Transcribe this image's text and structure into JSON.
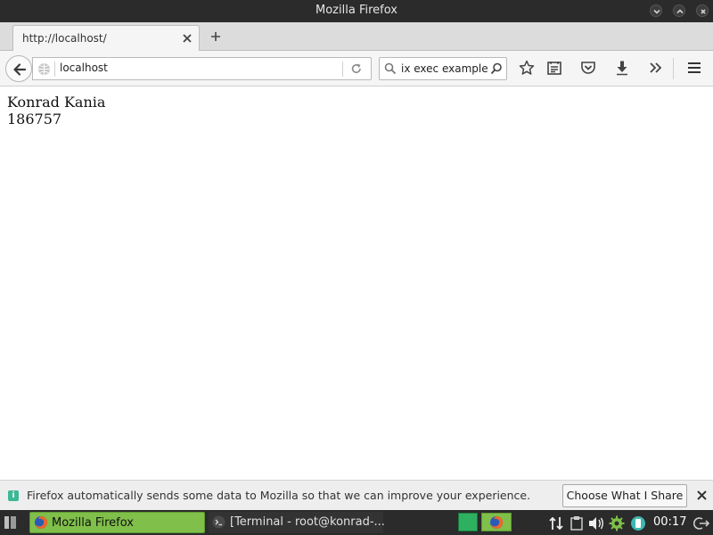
{
  "window": {
    "title": "Mozilla Firefox"
  },
  "tab": {
    "title": "http://localhost/"
  },
  "navbar": {
    "url": "localhost",
    "search_text": "ix exec example"
  },
  "content": {
    "lines": [
      "Konrad Kania",
      "186757"
    ]
  },
  "notification": {
    "message": "Firefox automatically sends some data to Mozilla so that we can improve your experience.",
    "button_label": "Choose What I Share"
  },
  "taskbar": {
    "tasks": [
      {
        "label": "Mozilla Firefox",
        "active": true
      },
      {
        "label": "[Terminal - root@konrad-...",
        "active": false
      }
    ],
    "clock": "00:17"
  },
  "colors": {
    "titlebar": "#2b2b2b",
    "taskbar_active": "#7fbf4a",
    "info_accent": "#3eb796"
  },
  "icons": [
    "chevron-down-icon",
    "chevron-up-icon",
    "close-circle-icon",
    "close-icon",
    "plus-icon",
    "back-arrow-icon",
    "globe-icon",
    "reload-icon",
    "search-icon",
    "star-icon",
    "reading-list-icon",
    "pocket-icon",
    "download-icon",
    "overflow-chevrons-icon",
    "hamburger-menu-icon",
    "info-icon",
    "firefox-logo-icon",
    "terminal-icon",
    "network-icon",
    "clipboard-icon",
    "volume-icon",
    "settings-icon",
    "power-icon"
  ]
}
